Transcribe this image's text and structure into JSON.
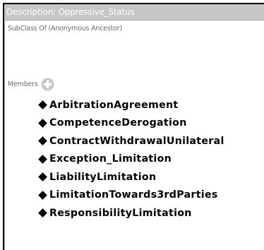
{
  "panel": {
    "title": "Description: Oppressive_Status"
  },
  "subclass": {
    "label": "SubClass Of (Anonymous Ancestor)"
  },
  "members": {
    "label": "Members",
    "add_icon": "plus-circle-icon",
    "items": [
      {
        "label": "ArbitrationAgreement"
      },
      {
        "label": "CompetenceDerogation"
      },
      {
        "label": "ContractWithdrawalUnilateral"
      },
      {
        "label": "Exception_Limitation"
      },
      {
        "label": "LiabilityLimitation"
      },
      {
        "label": "LimitationTowards3rdParties"
      },
      {
        "label": "ResponsibilityLimitation"
      }
    ]
  },
  "colors": {
    "titlebar_bg": "#c6c6c6",
    "title_text": "#ffffff",
    "add_icon": "#c8c8c8"
  }
}
